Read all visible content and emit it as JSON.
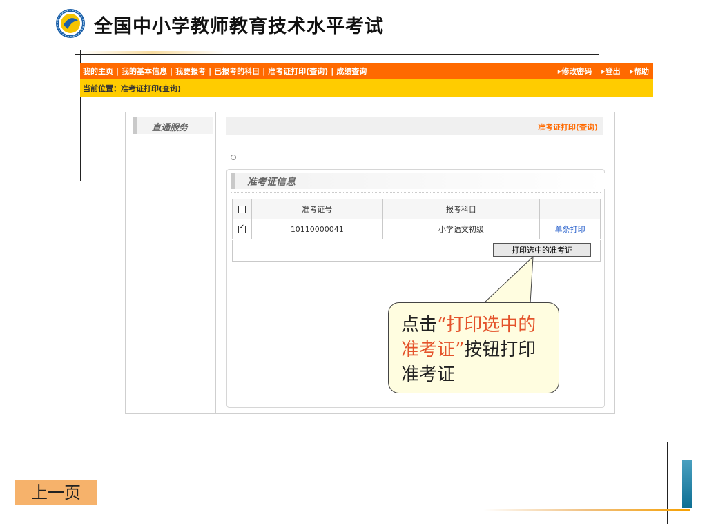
{
  "header": {
    "title": "全国中小学教师教育技术水平考试"
  },
  "nav": {
    "items": [
      "我的主页",
      "我的基本信息",
      "我要报考",
      "已报考的科目",
      "准考证打印(查询)",
      "成绩查询"
    ],
    "right": [
      "▸修改密码",
      "▸登出",
      "▸帮助"
    ]
  },
  "breadcrumb": "当前位置：准考证打印(查询)",
  "sidebar": {
    "title": "直通服务"
  },
  "content": {
    "header_label": "准考证打印(查询)",
    "section_title": "准考证信息",
    "table": {
      "columns": [
        "准考证号",
        "报考科目"
      ],
      "rows": [
        {
          "checked": true,
          "ticket_no": "10110000041",
          "subject": "小学语文初级",
          "action": "单条打印"
        }
      ]
    },
    "print_selected_label": "打印选中的准考证"
  },
  "callout": {
    "prefix": "点击",
    "highlight": "“打印选中的准考证”",
    "suffix": "按钮打印准考证"
  },
  "footer": {
    "prev_label": "上一页"
  },
  "colors": {
    "nav_bg": "#ff6a00",
    "crumb_bg": "#ffcc00",
    "accent_text": "#ff6a00",
    "link": "#1a56c8",
    "callout_bg": "#fffde0",
    "callout_highlight": "#e4532b",
    "prev_button_bg": "#f6b26b"
  }
}
